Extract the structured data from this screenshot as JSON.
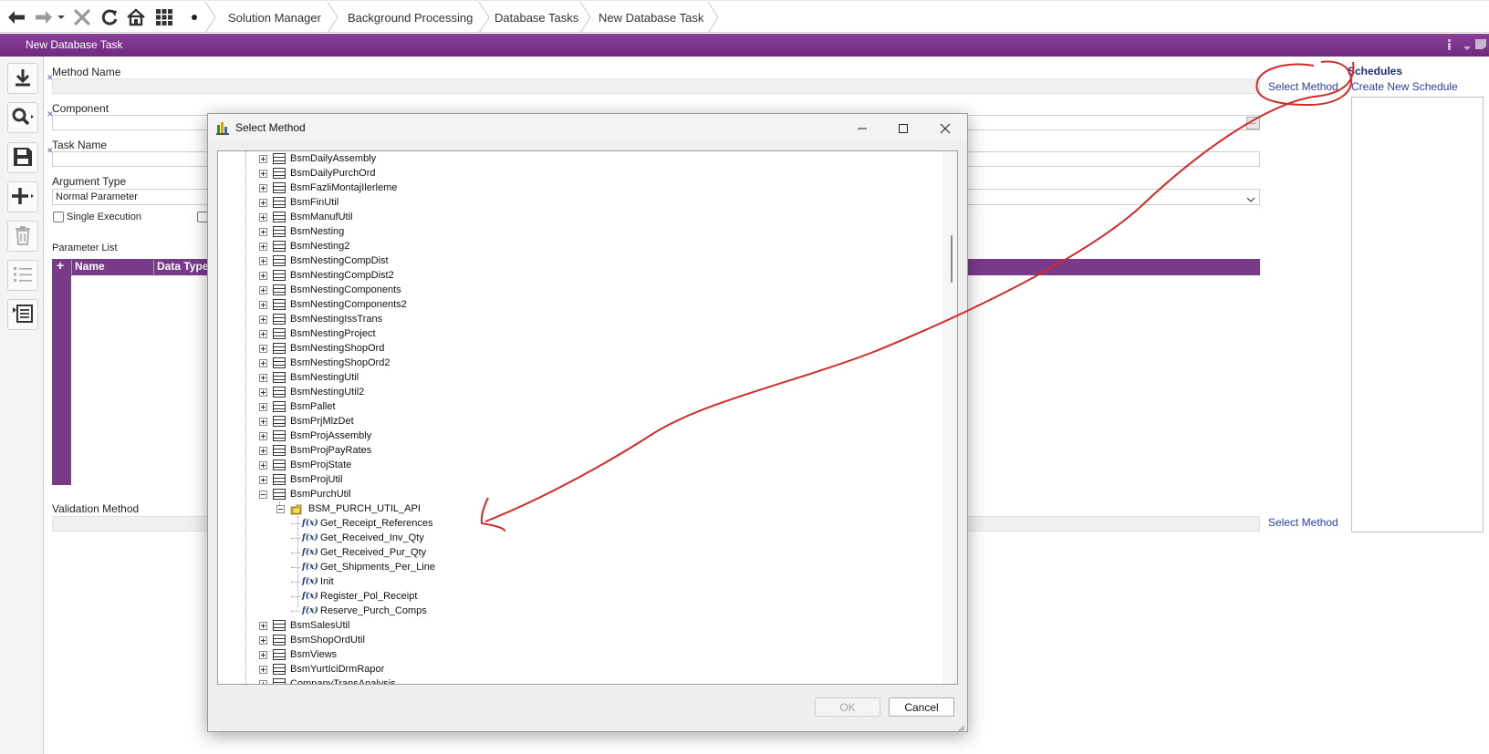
{
  "breadcrumbs": [
    "Solution Manager",
    "Background Processing",
    "Database Tasks",
    "New Database Task"
  ],
  "page_title": "New Database Task",
  "form": {
    "method_name_label": "Method Name",
    "component_label": "Component",
    "task_name_label": "Task Name",
    "argument_type_label": "Argument Type",
    "argument_type_value": "Normal Parameter",
    "single_execution_label": "Single Execution",
    "parameter_list_label": "Parameter List",
    "parameter_columns": [
      "Name",
      "Data Type"
    ],
    "validation_method_label": "Validation Method",
    "select_method_link": "Select Method",
    "select_method_link_2": "Select Method",
    "component_browse": "...",
    "add_row": "+"
  },
  "schedules": {
    "title": "Schedules",
    "create_link": "Create New Schedule"
  },
  "dialog": {
    "title": "Select Method",
    "ok_label": "OK",
    "cancel_label": "Cancel",
    "tree": [
      {
        "label": "BsmDailyAssembly",
        "kind": "table",
        "expand": "plus",
        "level": 0
      },
      {
        "label": "BsmDailyPurchOrd",
        "kind": "table",
        "expand": "plus",
        "level": 0
      },
      {
        "label": "BsmFazliMontajIlerleme",
        "kind": "table",
        "expand": "plus",
        "level": 0
      },
      {
        "label": "BsmFinUtil",
        "kind": "table",
        "expand": "plus",
        "level": 0
      },
      {
        "label": "BsmManufUtil",
        "kind": "table",
        "expand": "plus",
        "level": 0
      },
      {
        "label": "BsmNesting",
        "kind": "table",
        "expand": "plus",
        "level": 0
      },
      {
        "label": "BsmNesting2",
        "kind": "table",
        "expand": "plus",
        "level": 0
      },
      {
        "label": "BsmNestingCompDist",
        "kind": "table",
        "expand": "plus",
        "level": 0
      },
      {
        "label": "BsmNestingCompDist2",
        "kind": "table",
        "expand": "plus",
        "level": 0
      },
      {
        "label": "BsmNestingComponents",
        "kind": "table",
        "expand": "plus",
        "level": 0
      },
      {
        "label": "BsmNestingComponents2",
        "kind": "table",
        "expand": "plus",
        "level": 0
      },
      {
        "label": "BsmNestingIssTrans",
        "kind": "table",
        "expand": "plus",
        "level": 0
      },
      {
        "label": "BsmNestingProject",
        "kind": "table",
        "expand": "plus",
        "level": 0
      },
      {
        "label": "BsmNestingShopOrd",
        "kind": "table",
        "expand": "plus",
        "level": 0
      },
      {
        "label": "BsmNestingShopOrd2",
        "kind": "table",
        "expand": "plus",
        "level": 0
      },
      {
        "label": "BsmNestingUtil",
        "kind": "table",
        "expand": "plus",
        "level": 0
      },
      {
        "label": "BsmNestingUtil2",
        "kind": "table",
        "expand": "plus",
        "level": 0
      },
      {
        "label": "BsmPallet",
        "kind": "table",
        "expand": "plus",
        "level": 0
      },
      {
        "label": "BsmPrjMlzDet",
        "kind": "table",
        "expand": "plus",
        "level": 0
      },
      {
        "label": "BsmProjAssembly",
        "kind": "table",
        "expand": "plus",
        "level": 0
      },
      {
        "label": "BsmProjPayRates",
        "kind": "table",
        "expand": "plus",
        "level": 0
      },
      {
        "label": "BsmProjState",
        "kind": "table",
        "expand": "plus",
        "level": 0
      },
      {
        "label": "BsmProjUtil",
        "kind": "table",
        "expand": "plus",
        "level": 0
      },
      {
        "label": "BsmPurchUtil",
        "kind": "table",
        "expand": "minus",
        "level": 0
      },
      {
        "label": "BSM_PURCH_UTIL_API",
        "kind": "package",
        "expand": "minus",
        "level": 1
      },
      {
        "label": "Get_Receipt_References",
        "kind": "function",
        "expand": "none",
        "level": 2
      },
      {
        "label": "Get_Received_Inv_Qty",
        "kind": "function",
        "expand": "none",
        "level": 2
      },
      {
        "label": "Get_Received_Pur_Qty",
        "kind": "function",
        "expand": "none",
        "level": 2
      },
      {
        "label": "Get_Shipments_Per_Line",
        "kind": "function",
        "expand": "none",
        "level": 2
      },
      {
        "label": "Init",
        "kind": "function",
        "expand": "none",
        "level": 2
      },
      {
        "label": "Register_Pol_Receipt",
        "kind": "function",
        "expand": "none",
        "level": 2
      },
      {
        "label": "Reserve_Purch_Comps",
        "kind": "function",
        "expand": "none",
        "level": 2
      },
      {
        "label": "BsmSalesUtil",
        "kind": "table",
        "expand": "plus",
        "level": 0
      },
      {
        "label": "BsmShopOrdUtil",
        "kind": "table",
        "expand": "plus",
        "level": 0
      },
      {
        "label": "BsmViews",
        "kind": "table",
        "expand": "plus",
        "level": 0
      },
      {
        "label": "BsmYurtIciDrmRapor",
        "kind": "table",
        "expand": "plus",
        "level": 0
      },
      {
        "label": "CompanyTransAnalysis",
        "kind": "table",
        "expand": "plus",
        "level": 0
      }
    ],
    "function_icon_text": "f(x)"
  },
  "colors": {
    "accent_purple": "#7a3a8a",
    "link_blue": "#2b3ea6",
    "annotation_red": "#d42a2a"
  },
  "icons": {
    "nav": [
      "back-arrow-icon",
      "forward-arrow-icon",
      "close-icon",
      "refresh-icon",
      "home-icon",
      "grid-icon",
      "dot-icon"
    ],
    "toolbar": [
      "download-icon",
      "search-icon",
      "save-icon",
      "add-icon",
      "delete-icon",
      "list-icon",
      "details-icon"
    ]
  }
}
